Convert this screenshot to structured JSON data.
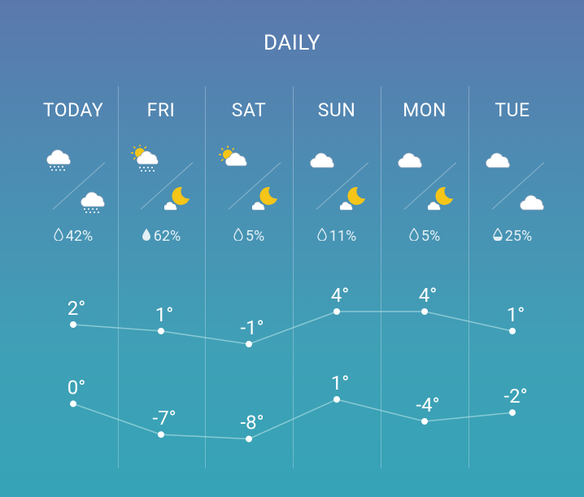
{
  "title": "DAILY",
  "days": [
    {
      "label": "TODAY",
      "icon_day": "cloud-snow-icon",
      "icon_night": "cloud-snow-icon",
      "precip_icon": "drop-outline-icon",
      "precip": "42%",
      "high": "2°",
      "low": "0°",
      "high_value": 2,
      "low_value": 0
    },
    {
      "label": "FRI",
      "icon_day": "partly-sunny-snow-icon",
      "icon_night": "moon-cloud-icon",
      "precip_icon": "drop-filled-icon",
      "precip": "62%",
      "high": "1°",
      "low": "-7°",
      "high_value": 1,
      "low_value": -7
    },
    {
      "label": "SAT",
      "icon_day": "partly-sunny-icon",
      "icon_night": "moon-cloud-icon",
      "precip_icon": "drop-outline-icon",
      "precip": "5%",
      "high": "-1°",
      "low": "-8°",
      "high_value": -1,
      "low_value": -8
    },
    {
      "label": "SUN",
      "icon_day": "cloud-icon",
      "icon_night": "moon-cloud-icon",
      "precip_icon": "drop-outline-icon",
      "precip": "11%",
      "high": "4°",
      "low": "1°",
      "high_value": 4,
      "low_value": 1
    },
    {
      "label": "MON",
      "icon_day": "cloud-icon",
      "icon_night": "moon-cloud-icon",
      "precip_icon": "drop-outline-icon",
      "precip": "5%",
      "high": "4°",
      "low": "-4°",
      "high_value": 4,
      "low_value": -4
    },
    {
      "label": "TUE",
      "icon_day": "cloud-icon",
      "icon_night": "cloud-icon",
      "precip_icon": "drop-half-icon",
      "precip": "25%",
      "high": "1°",
      "low": "-2°",
      "high_value": 1,
      "low_value": -2
    }
  ],
  "colors": {
    "text": "#ffffff",
    "sun": "#f5c518",
    "moon": "#f5c518",
    "line": "#a8dbe3"
  }
}
